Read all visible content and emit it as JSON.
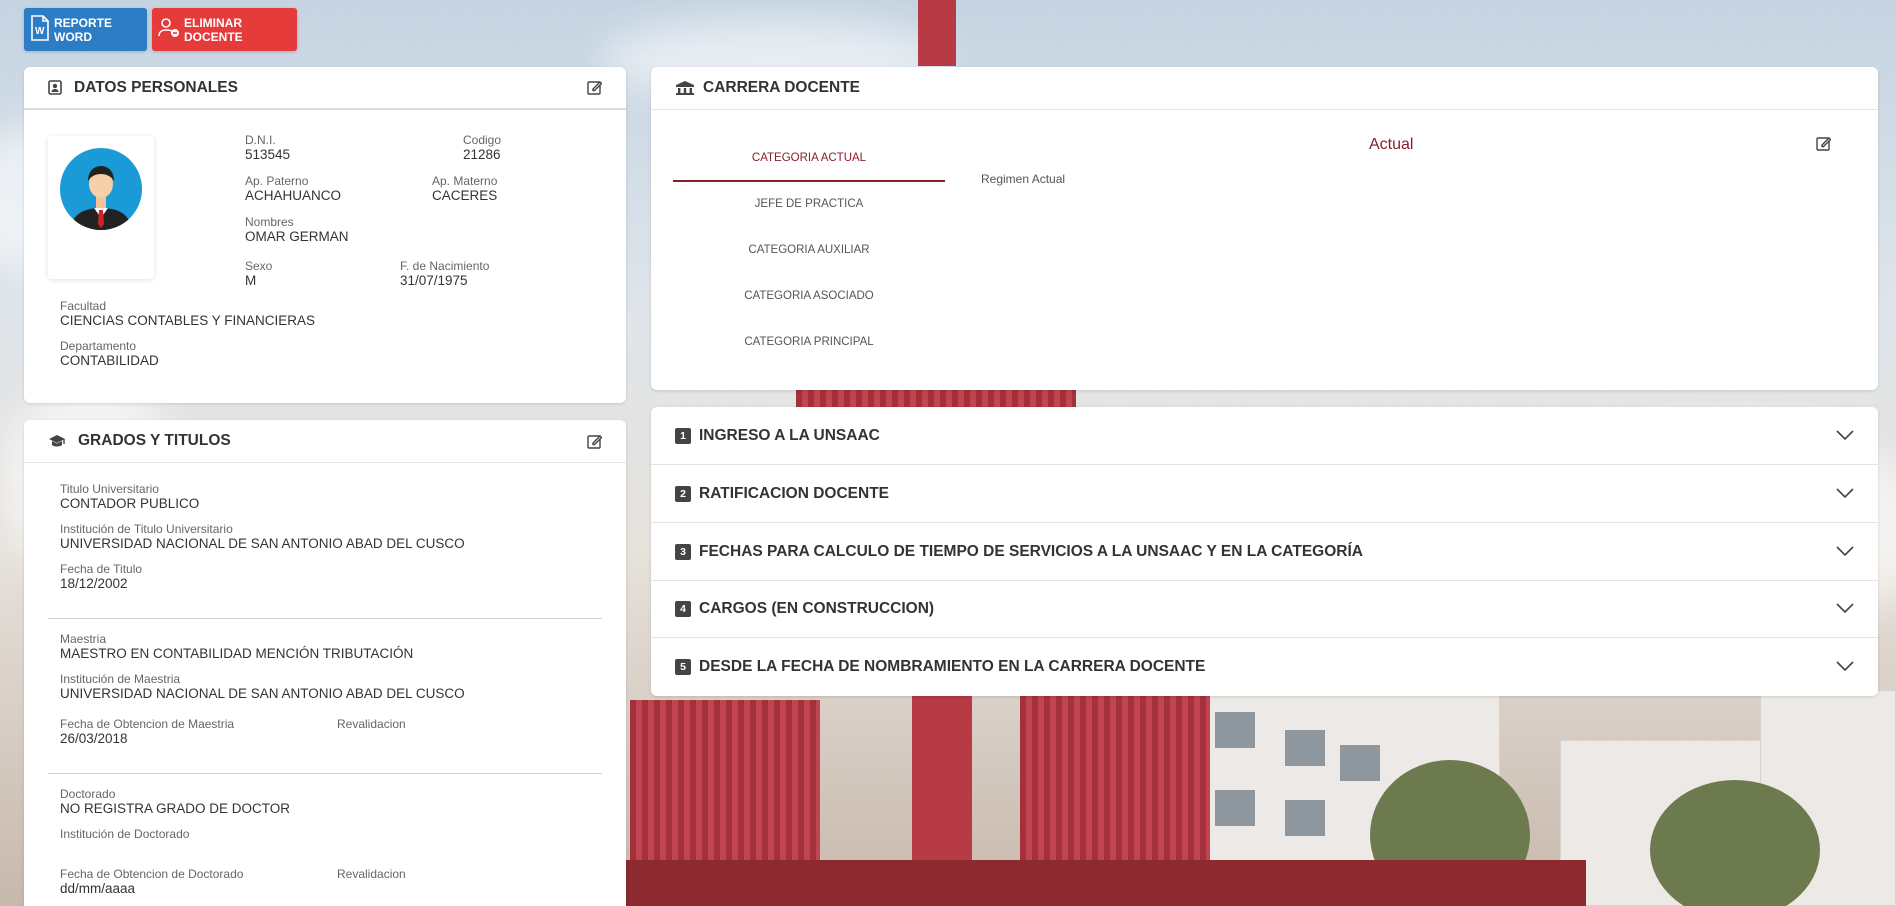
{
  "toolbar": {
    "report_word_label": "REPORTE WORD",
    "delete_teacher_label": "ELIMINAR DOCENTE"
  },
  "personal": {
    "title": "DATOS PERSONALES",
    "dni_label": "D.N.I.",
    "dni": "513545",
    "codigo_label": "Codigo",
    "codigo": "21286",
    "ap_paterno_label": "Ap. Paterno",
    "ap_paterno": "ACHAHUANCO",
    "ap_materno_label": "Ap. Materno",
    "ap_materno": "CACERES",
    "nombres_label": "Nombres",
    "nombres": "OMAR GERMAN",
    "sexo_label": "Sexo",
    "sexo": "M",
    "nacimiento_label": "F. de Nacimiento",
    "nacimiento": "31/07/1975",
    "facultad_label": "Facultad",
    "facultad": "CIENCIAS CONTABLES Y FINANCIERAS",
    "departamento_label": "Departamento",
    "departamento": "CONTABILIDAD"
  },
  "grados": {
    "title": "GRADOS Y TITULOS",
    "titulo_label": "Titulo Universitario",
    "titulo": "CONTADOR PUBLICO",
    "inst_titulo_label": "Institución de Titulo Universitario",
    "inst_titulo": "UNIVERSIDAD NACIONAL DE SAN ANTONIO ABAD DEL CUSCO",
    "fecha_titulo_label": "Fecha de Titulo",
    "fecha_titulo": "18/12/2002",
    "maestria_label": "Maestria",
    "maestria": "MAESTRO EN CONTABILIDAD MENCIÓN TRIBUTACIÓN",
    "inst_maestria_label": "Institución de Maestria",
    "inst_maestria": "UNIVERSIDAD NACIONAL DE SAN ANTONIO ABAD DEL CUSCO",
    "fecha_maestria_label": "Fecha de Obtencion de Maestria",
    "fecha_maestria": "26/03/2018",
    "revalidacion_label": "Revalidacion",
    "doctorado_label": "Doctorado",
    "doctorado": "NO REGISTRA GRADO DE DOCTOR",
    "inst_doctorado_label": "Institución de Doctorado",
    "fecha_doctorado_label": "Fecha de Obtencion de Doctorado",
    "fecha_doctorado": "dd/mm/aaaa"
  },
  "carrera": {
    "title": "CARRERA DOCENTE",
    "tabs": [
      "CATEGORIA ACTUAL",
      "JEFE DE PRACTICA",
      "CATEGORIA AUXILIAR",
      "CATEGORIA ASOCIADO",
      "CATEGORIA PRINCIPAL"
    ],
    "active_tab": "CATEGORIA ACTUAL",
    "panel_title": "Actual",
    "regimen_label": "Regimen Actual"
  },
  "accordion": [
    {
      "num": "1",
      "title": "INGRESO A LA UNSAAC"
    },
    {
      "num": "2",
      "title": "RATIFICACION DOCENTE"
    },
    {
      "num": "3",
      "title": "FECHAS PARA CALCULO DE TIEMPO DE SERVICIOS A LA UNSAAC Y EN LA CATEGORÍA"
    },
    {
      "num": "4",
      "title": "CARGOS (EN CONSTRUCCION)"
    },
    {
      "num": "5",
      "title": "DESDE LA FECHA DE NOMBRAMIENTO EN LA CARRERA DOCENTE"
    }
  ],
  "colors": {
    "accent": "#8b1d2c",
    "word_button": "#2d7cc6",
    "delete_button": "#e53b3b"
  },
  "icons": [
    "word-file-icon",
    "remove-user-icon",
    "contact-card-icon",
    "edit-icon",
    "graduation-cap-icon",
    "university-icon",
    "chevron-down-icon"
  ]
}
